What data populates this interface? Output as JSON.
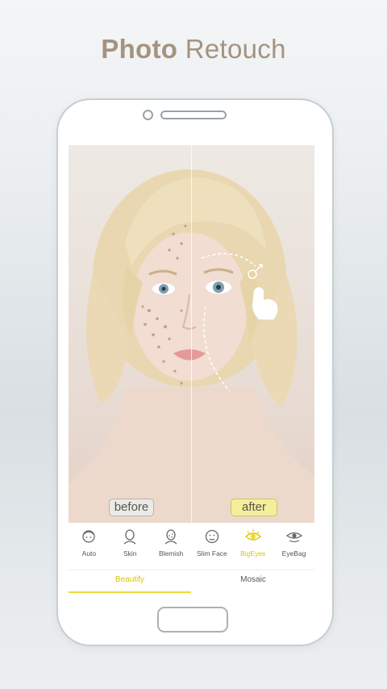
{
  "headline": {
    "bold": "Photo",
    "light": "Retouch"
  },
  "photo": {
    "before_label": "before",
    "after_label": "after"
  },
  "tools": [
    {
      "label": "Auto",
      "icon": "auto-face-icon",
      "active": false
    },
    {
      "label": "Skin",
      "icon": "skin-icon",
      "active": false
    },
    {
      "label": "Blemish",
      "icon": "blemish-icon",
      "active": false
    },
    {
      "label": "Slim Face",
      "icon": "slim-face-icon",
      "active": false
    },
    {
      "label": "BigEyes",
      "icon": "big-eyes-icon",
      "active": true
    },
    {
      "label": "EyeBag",
      "icon": "eye-bag-icon",
      "active": false
    }
  ],
  "tabs": [
    {
      "label": "Beautify",
      "active": true
    },
    {
      "label": "Mosaic",
      "active": false
    }
  ],
  "colors": {
    "accent": "#d9c700",
    "headline": "#a5937f",
    "after_badge": "#f4ef9a"
  }
}
